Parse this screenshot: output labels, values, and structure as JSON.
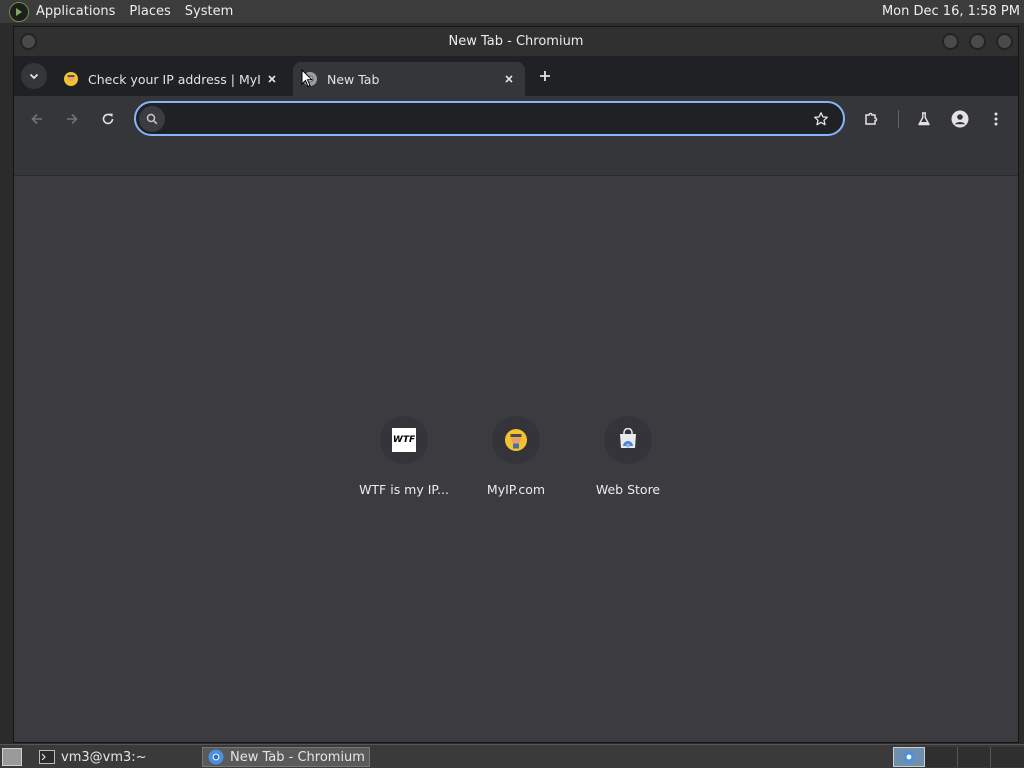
{
  "top_panel": {
    "menus": [
      "Applications",
      "Places",
      "System"
    ],
    "clock": "Mon Dec 16,  1:58 PM"
  },
  "window": {
    "title": "New Tab - Chromium"
  },
  "tabs": [
    {
      "title": "Check your IP address | MyIP",
      "favicon": "myip-favicon",
      "active": false
    },
    {
      "title": "New Tab",
      "favicon": "chromium-favicon",
      "active": true
    }
  ],
  "toolbar": {
    "omnibox_value": "",
    "icons": [
      "back-icon",
      "forward-icon",
      "reload-icon",
      "search-icon",
      "bookmark-star-icon",
      "extensions-icon",
      "labs-flask-icon",
      "profile-icon",
      "menu-kebab-icon"
    ]
  },
  "shortcuts": [
    {
      "label": "WTF is my IP...",
      "icon": "wtf-icon",
      "icon_text": "WTF"
    },
    {
      "label": "MyIP.com",
      "icon": "myip-icon"
    },
    {
      "label": "Web Store",
      "icon": "web-store-icon"
    }
  ],
  "taskbar": {
    "items": [
      {
        "label": "vm3@vm3:~",
        "icon": "terminal-icon",
        "active": false
      },
      {
        "label": "New Tab - Chromium",
        "icon": "chromium-icon",
        "active": true
      }
    ]
  },
  "colors": {
    "omnibox_focus": "#8ab4f8",
    "ntp_background": "#3c3b40",
    "tab_strip": "#202124",
    "toolbar": "#35363a"
  }
}
